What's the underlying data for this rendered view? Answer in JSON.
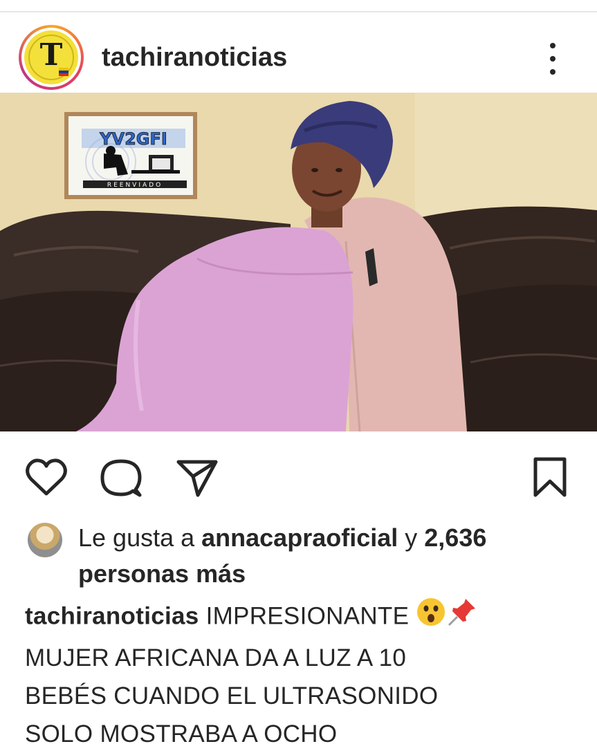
{
  "post": {
    "username": "tachiranoticias",
    "profile_logo_letter": "T",
    "more_icon": "more-vertical-icon"
  },
  "image": {
    "watermark_text": "YV2GFI",
    "watermark_subtext": "REENVIADO"
  },
  "actions": {
    "like_icon": "heart-icon",
    "comment_icon": "comment-icon",
    "share_icon": "send-icon",
    "save_icon": "bookmark-icon"
  },
  "likes": {
    "prefix": "Le gusta a ",
    "user": "annacapraoficial",
    "connector": " y ",
    "count": "2,636",
    "suffix": "personas más"
  },
  "caption": {
    "username": "tachiranoticias",
    "line1": "IMPRESIONANTE",
    "emojis": [
      "astonished-face-emoji",
      "pushpin-emoji"
    ],
    "line2": "MUJER AFRICANA DA A LUZ A 10",
    "line3": "BEBÉS CUANDO EL ULTRASONIDO",
    "line4": "SOLO MOSTRABA A OCHO"
  },
  "colors": {
    "text": "#262626",
    "avatar_ring": "#e4405f",
    "logo_yellow": "#f4e03a"
  }
}
